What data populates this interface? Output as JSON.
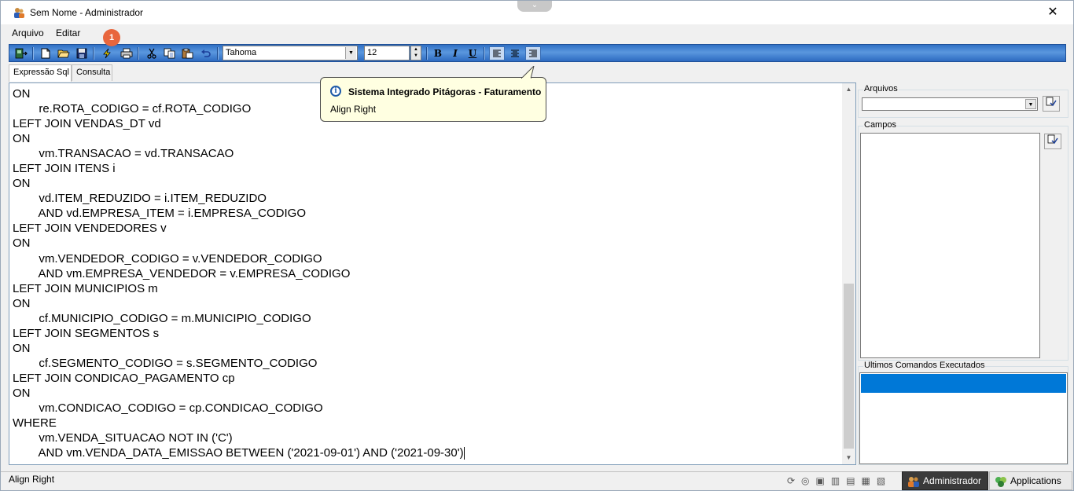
{
  "window": {
    "title": "Sem Nome - Administrador",
    "close_glyph": "✕",
    "collapse_glyph": "⌄"
  },
  "menu": {
    "items": [
      "Arquivo",
      "Editar"
    ]
  },
  "badge": "1",
  "toolbar": {
    "font_name": "Tahoma",
    "font_size": "12",
    "bold_label": "B",
    "italic_label": "I",
    "underline_label": "U",
    "icons": [
      "exit-icon",
      "new-file-icon",
      "open-folder-icon",
      "save-icon",
      "execute-icon",
      "print-icon",
      "cut-icon",
      "copy-icon",
      "paste-icon",
      "undo-icon",
      "align-left-icon",
      "align-center-icon",
      "align-right-icon"
    ]
  },
  "tabs": [
    "Expressão Sql",
    "Consulta"
  ],
  "editor": {
    "lines": [
      "ON",
      "        re.ROTA_CODIGO = cf.ROTA_CODIGO",
      "LEFT JOIN VENDAS_DT vd",
      "ON",
      "        vm.TRANSACAO = vd.TRANSACAO",
      "LEFT JOIN ITENS i",
      "ON",
      "        vd.ITEM_REDUZIDO = i.ITEM_REDUZIDO",
      "        AND vd.EMPRESA_ITEM = i.EMPRESA_CODIGO",
      "LEFT JOIN VENDEDORES v",
      "ON",
      "        vm.VENDEDOR_CODIGO = v.VENDEDOR_CODIGO",
      "        AND vm.EMPRESA_VENDEDOR = v.EMPRESA_CODIGO",
      "LEFT JOIN MUNICIPIOS m",
      "ON",
      "        cf.MUNICIPIO_CODIGO = m.MUNICIPIO_CODIGO",
      "LEFT JOIN SEGMENTOS s",
      "ON",
      "        cf.SEGMENTO_CODIGO = s.SEGMENTO_CODIGO",
      "LEFT JOIN CONDICAO_PAGAMENTO cp",
      "ON",
      "        vm.CONDICAO_CODIGO = cp.CONDICAO_CODIGO",
      "WHERE",
      "        vm.VENDA_SITUACAO NOT IN ('C')",
      "        AND vm.VENDA_DATA_EMISSAO BETWEEN ('2021-09-01') AND ('2021-09-30')"
    ]
  },
  "tooltip": {
    "title": "Sistema Integrado Pitágoras - Faturamento",
    "body": "Align Right"
  },
  "side_panel": {
    "arquivos_label": "Arquivos",
    "campos_label": "Campos",
    "ultimos_label": "Ultimos Comandos Executados"
  },
  "status": {
    "text": "Align Right"
  },
  "taskbar": {
    "user_button": "Administrador",
    "apps_button": "Applications"
  },
  "colors": {
    "toolbar_blue": "#2f6fc4",
    "selection_blue": "#0078d7",
    "badge_orange": "#e8663d",
    "tooltip_bg": "#ffffe1"
  }
}
